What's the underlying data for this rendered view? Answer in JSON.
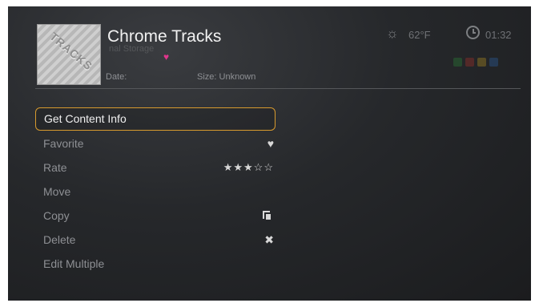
{
  "header": {
    "title": "Chrome Tracks",
    "subtitle": "nal Storage",
    "thumbnail_text": "TRACKS",
    "date_label": "Date:",
    "size_label": "Size: Unknown"
  },
  "status": {
    "temperature": "62°F",
    "time": "01:32",
    "weather_icon": "sun-icon",
    "clock_icon": "clock-icon"
  },
  "color_keys": [
    "#2e9e3a",
    "#d1342b",
    "#e0b21f",
    "#2f74c9"
  ],
  "menu": {
    "items": [
      {
        "label": "Get Content Info",
        "selected": true
      },
      {
        "label": "Favorite",
        "trail": "♥",
        "trail_icon": "heart-icon"
      },
      {
        "label": "Rate",
        "trail": "★★★☆☆",
        "rating": 3,
        "rating_max": 5
      },
      {
        "label": "Move"
      },
      {
        "label": "Copy",
        "trail_icon": "copy-icon"
      },
      {
        "label": "Delete",
        "trail": "✖",
        "trail_icon": "close-icon"
      },
      {
        "label": "Edit Multiple"
      }
    ]
  },
  "colors": {
    "accent": "#d79a2e",
    "favorite_heart": "#e0368c"
  }
}
